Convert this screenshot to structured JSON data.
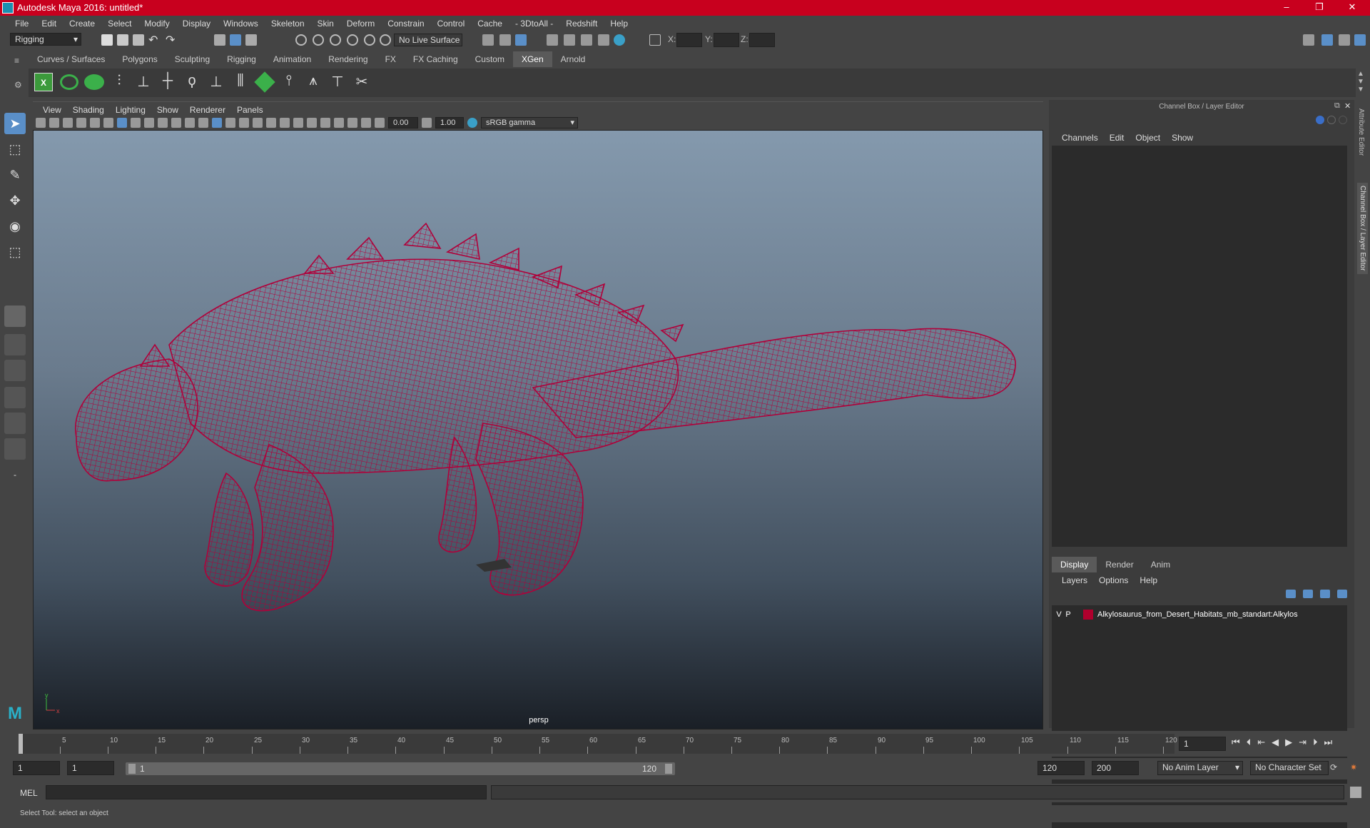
{
  "app": {
    "title": "Autodesk Maya 2016: untitled*"
  },
  "menus": [
    "File",
    "Edit",
    "Create",
    "Select",
    "Modify",
    "Display",
    "Windows",
    "Skeleton",
    "Skin",
    "Deform",
    "Constrain",
    "Control",
    "Cache",
    "- 3DtoAll -",
    "Redshift",
    "Help"
  ],
  "status_line": {
    "mode": "Rigging",
    "live_surface": "No Live Surface",
    "x_label": "X:",
    "y_label": "Y:",
    "z_label": "Z:"
  },
  "shelf_tabs": [
    "Curves / Surfaces",
    "Polygons",
    "Sculpting",
    "Rigging",
    "Animation",
    "Rendering",
    "FX",
    "FX Caching",
    "Custom",
    "XGen",
    "Arnold"
  ],
  "shelf_active": "XGen",
  "viewport": {
    "menus": [
      "View",
      "Shading",
      "Lighting",
      "Show",
      "Renderer",
      "Panels"
    ],
    "exposure": "0.00",
    "gamma": "1.00",
    "color_space": "sRGB gamma",
    "camera": "persp",
    "wire_color": "#b0003a",
    "axis": {
      "y": "y",
      "x": "x"
    }
  },
  "channel_box": {
    "title": "Channel Box / Layer Editor",
    "menus": [
      "Channels",
      "Edit",
      "Object",
      "Show"
    ]
  },
  "layer_editor": {
    "tabs": [
      "Display",
      "Render",
      "Anim"
    ],
    "active_tab": "Display",
    "menus": [
      "Layers",
      "Options",
      "Help"
    ],
    "layer": {
      "v": "V",
      "p": "P",
      "color": "#b0002d",
      "name": "Alkylosaurus_from_Desert_Habitats_mb_standart:Alkylos"
    }
  },
  "side_tabs": [
    "Attribute Editor",
    "Channel Box / Layer Editor"
  ],
  "timeline": {
    "ticks": [
      "1",
      "5",
      "10",
      "15",
      "20",
      "25",
      "30",
      "35",
      "40",
      "45",
      "50",
      "55",
      "60",
      "65",
      "70",
      "75",
      "80",
      "85",
      "90",
      "95",
      "100",
      "105",
      "110",
      "115",
      "120"
    ],
    "current_frame": "1"
  },
  "range": {
    "start": "1",
    "anim_start": "1",
    "slider_start": "1",
    "slider_end": "120",
    "end": "120",
    "anim_end": "200",
    "anim_layer": "No Anim Layer",
    "character_set": "No Character Set"
  },
  "command": {
    "lang": "MEL"
  },
  "help_line": "Select Tool: select an object"
}
